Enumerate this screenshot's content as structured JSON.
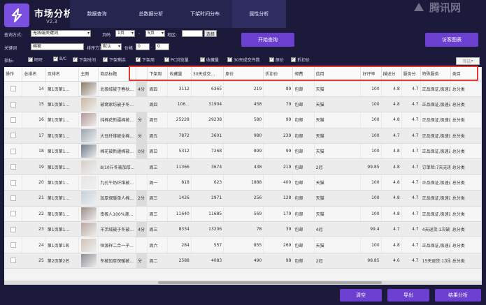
{
  "app": {
    "title": "市场分析",
    "version": "V2.3",
    "brand": "腾讯网"
  },
  "nav": {
    "tabs": [
      "数据查询",
      "总数据分析",
      "下架时间分布",
      "属性分析"
    ]
  },
  "query": {
    "mode_label": "查询方式:",
    "mode_value": "无线端关键词",
    "page_label": "页码",
    "page_from": "1页",
    "page_to": "5页",
    "region_label": "地区:",
    "region_value": "",
    "select_btn": "选择",
    "keyword_label": "关键词",
    "keyword_value": "棉被",
    "sort_label": "排序方式",
    "sort_value": "默认",
    "price_label": "价格",
    "price_min": "0",
    "price_max": "0",
    "start_btn": "开始查询",
    "chart_btn": "访客图表"
  },
  "indicators": {
    "label": "指标:",
    "items": [
      {
        "label": "旺旺",
        "checked": true
      },
      {
        "label": "B/C",
        "checked": true
      },
      {
        "label": "下架时间",
        "checked": true
      },
      {
        "label": "下架剩余",
        "checked": true
      },
      {
        "label": "下架周",
        "checked": true
      },
      {
        "label": "PC浏览量",
        "checked": true
      },
      {
        "label": "收藏量",
        "checked": true
      },
      {
        "label": "30天成交件数",
        "checked": true
      },
      {
        "label": "原价",
        "checked": true
      },
      {
        "label": "折扣价",
        "checked": true
      }
    ],
    "filter_btn": "筛选"
  },
  "table": {
    "headers": [
      "操作",
      "总排名",
      "页排名",
      "主图",
      "商品标题",
      "",
      "下架周",
      "收藏量",
      "30天成交...",
      "原价",
      "折扣价",
      "邮费",
      "信用",
      "好评率",
      "描述分",
      "服务分",
      "特殊服务",
      "类目"
    ],
    "rows": [
      {
        "rank": "14",
        "page": "第1页第1...",
        "img": "#8a7a6a",
        "title": "北极绒被子春秋...",
        "rem": "4分",
        "week": "周四",
        "fav": "3112",
        "sold": "6365",
        "orig": "219",
        "disc": "89",
        "post": "包邮",
        "credit": "天猫",
        "good": "100",
        "desc": "4.8",
        "serv": "4.7",
        "special": "正品保证,极速退...",
        "cat": "总分类"
      },
      {
        "rank": "15",
        "page": "第1页第1...",
        "img": "#c9b7a3",
        "title": "被窝家纺被子冬...",
        "rem": "",
        "week": "周四",
        "fav": "106...",
        "sold": "31904",
        "orig": "458",
        "disc": "79",
        "post": "包邮",
        "credit": "天猫",
        "good": "100",
        "desc": "4.8",
        "serv": "4.7",
        "special": "正品保证,极速退...",
        "cat": "总分类"
      },
      {
        "rank": "16",
        "page": "第1页第1...",
        "img": "#b49898",
        "title": "纯棉花新疆棉被...",
        "rem": "分",
        "week": "周日",
        "fav": "25228",
        "sold": "29238",
        "orig": "580",
        "disc": "99",
        "post": "包邮",
        "credit": "天猫",
        "good": "100",
        "desc": "4.8",
        "serv": "4.7",
        "special": "正品保证,极速退...",
        "cat": "总分类"
      },
      {
        "rank": "17",
        "page": "第1页第1...",
        "img": "#9aa7b0",
        "title": "大豆纤维被全棉...",
        "rem": "分",
        "week": "周五",
        "fav": "7872",
        "sold": "3601",
        "orig": "980",
        "disc": "239",
        "post": "包邮",
        "credit": "天猫",
        "good": "100",
        "desc": "4.7",
        "serv": "4.7",
        "special": "正品保证,极速退...",
        "cat": "总分类"
      },
      {
        "rank": "18",
        "page": "第1页第1...",
        "img": "#6f7c88",
        "title": "棉花被新疆棉被...",
        "rem": "0分",
        "week": "周日",
        "fav": "5312",
        "sold": "7268",
        "orig": "899",
        "disc": "99",
        "post": "包邮",
        "credit": "天猫",
        "good": "100",
        "desc": "4.8",
        "serv": "4.7",
        "special": "正品保证,极速退...",
        "cat": "总分类"
      },
      {
        "rank": "19",
        "page": "第1页第1...",
        "img": "#d7cfc7",
        "title": "8/10斤冬被加厚...",
        "rem": "",
        "week": "周三",
        "fav": "11366",
        "sold": "3674",
        "orig": "438",
        "disc": "219",
        "post": "包邮",
        "credit": "2冠",
        "good": "99.85",
        "desc": "4.8",
        "serv": "4.7",
        "special": "订单险:7天无理...",
        "cat": "总分类"
      },
      {
        "rank": "20",
        "page": "第1页第1...",
        "img": "#e8e6e4",
        "title": "九孔牛奶纤维被...",
        "rem": "",
        "week": "周一",
        "fav": "818",
        "sold": "623",
        "orig": "1888",
        "disc": "400",
        "post": "包邮",
        "credit": "天猫",
        "good": "100",
        "desc": "4.8",
        "serv": "4.7",
        "special": "正品保证,极速退...",
        "cat": "总分类"
      },
      {
        "rank": "21",
        "page": "第1页第1...",
        "img": "#c6d0dc",
        "title": "加厚保暖单人棉...",
        "rem": "2分",
        "week": "周三",
        "fav": "1426",
        "sold": "2971",
        "orig": "256",
        "disc": "128",
        "post": "包邮",
        "credit": "天猫",
        "good": "100",
        "desc": "4.8",
        "serv": "4.7",
        "special": "正品保证,极速退...",
        "cat": "总分类"
      },
      {
        "rank": "22",
        "page": "第1页第1...",
        "img": "#9b8e86",
        "title": "南极人100%澳...",
        "rem": "",
        "week": "周三",
        "fav": "11640",
        "sold": "11685",
        "orig": "569",
        "disc": "179",
        "post": "包邮",
        "credit": "天猫",
        "good": "100",
        "desc": "4.8",
        "serv": "4.7",
        "special": "正品保证,极速退...",
        "cat": "总分类"
      },
      {
        "rank": "23",
        "page": "第1页第1...",
        "img": "#b8a6a0",
        "title": "羊羔绒被子冬被...",
        "rem": "4分",
        "week": "周三",
        "fav": "8334",
        "sold": "13206",
        "orig": "78",
        "disc": "39",
        "post": "包邮",
        "credit": "4冠",
        "good": "99.4",
        "desc": "4.7",
        "serv": "4.7",
        "special": "4天退货:1次破损...",
        "cat": "总分类"
      },
      {
        "rank": "24",
        "page": "第1页第1名",
        "img": "#cfc4b8",
        "title": "恒源祥二合一子...",
        "rem": "",
        "week": "周六",
        "fav": "284",
        "sold": "557",
        "orig": "855",
        "disc": "269",
        "post": "包邮",
        "credit": "天猫",
        "good": "100",
        "desc": "4.8",
        "serv": "4.7",
        "special": "正品保证,极速退...",
        "cat": "总分类"
      },
      {
        "rank": "25",
        "page": "第2页第2名",
        "img": "#8d8f95",
        "title": "冬被加厚保暖被...",
        "rem": "分",
        "week": "周二",
        "fav": "2588",
        "sold": "4083",
        "orig": "490",
        "disc": "98",
        "post": "包邮",
        "credit": "2冠",
        "good": "98.85",
        "desc": "4.6",
        "serv": "4.7",
        "special": "15天退货:1次破...",
        "cat": "总分类"
      }
    ]
  },
  "footer": {
    "clear_btn": "清空",
    "export_btn": "导出",
    "analyze_btn": "结果分析"
  }
}
